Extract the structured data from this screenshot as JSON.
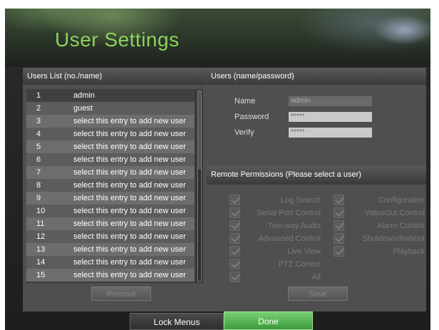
{
  "header": {
    "title": "User Settings"
  },
  "users_list": {
    "title": "Users List (no./name)",
    "rows": [
      {
        "no": "1",
        "name": "admin"
      },
      {
        "no": "2",
        "name": "guest"
      },
      {
        "no": "3",
        "name": "select this entry to add new user"
      },
      {
        "no": "4",
        "name": "select this entry to add new user"
      },
      {
        "no": "5",
        "name": "select this entry to add new user"
      },
      {
        "no": "6",
        "name": "select this entry to add new user"
      },
      {
        "no": "7",
        "name": "select this entry to add new user"
      },
      {
        "no": "8",
        "name": "select this entry to add new user"
      },
      {
        "no": "9",
        "name": "select this entry to add new user"
      },
      {
        "no": "10",
        "name": "select this entry to add new user"
      },
      {
        "no": "11",
        "name": "select this entry to add new user"
      },
      {
        "no": "12",
        "name": "select this entry to add new user"
      },
      {
        "no": "13",
        "name": "select this entry to add new user"
      },
      {
        "no": "14",
        "name": "select this entry to add new user"
      },
      {
        "no": "15",
        "name": "select this entry to add new user"
      }
    ],
    "remove_label": "Remove"
  },
  "user_details": {
    "title": "Users (name/password)",
    "name_label": "Name",
    "name_value": "admin",
    "password_label": "Password",
    "password_value": "*****",
    "verify_label": "Verify",
    "verify_value": "*****"
  },
  "permissions": {
    "title": "Remote Permissions (Please select a user)",
    "left": [
      "Log Search",
      "Serial Port Control",
      "Two-way Audio",
      "Advanced Control",
      "Live View",
      "PTZ Control",
      "All"
    ],
    "right": [
      "Configuration",
      "VideoOut Control",
      "Alarm Control",
      "Shutdown/Reboot",
      "Playback"
    ],
    "save_label": "Save"
  },
  "footer": {
    "lock_label": "Lock Menus",
    "done_label": "Done"
  },
  "colors": {
    "title_green": "#8bd35a",
    "done_green": "#5cb957",
    "panel_gray": "#4f4f4f"
  }
}
